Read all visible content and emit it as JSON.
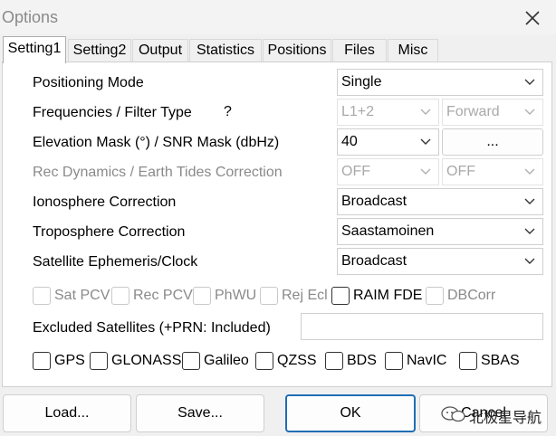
{
  "window": {
    "title": "Options"
  },
  "tabs": [
    "Setting1",
    "Setting2",
    "Output",
    "Statistics",
    "Positions",
    "Files",
    "Misc"
  ],
  "settings": {
    "positioning_mode": {
      "label": "Positioning Mode",
      "value": "Single"
    },
    "frequencies": {
      "label": "Frequencies / Filter Type",
      "help": "?",
      "freq_value": "L1+2",
      "filter_value": "Forward"
    },
    "elevation": {
      "label": "Elevation Mask (°) / SNR Mask (dbHz)",
      "value": "40",
      "snr_button": "..."
    },
    "dynamics": {
      "label": "Rec Dynamics / Earth Tides Correction",
      "dyn_value": "OFF",
      "tides_value": "OFF"
    },
    "ionosphere": {
      "label": "Ionosphere Correction",
      "value": "Broadcast"
    },
    "troposphere": {
      "label": "Troposphere Correction",
      "value": "Saastamoinen"
    },
    "ephemeris": {
      "label": "Satellite Ephemeris/Clock",
      "value": "Broadcast"
    },
    "options": [
      "Sat PCV",
      "Rec PCV",
      "PhWU",
      "Rej Ecl",
      "RAIM FDE",
      "DBCorr"
    ],
    "excluded": {
      "label": "Excluded Satellites (+PRN: Included)",
      "value": ""
    },
    "constellations": [
      "GPS",
      "GLONASS",
      "Galileo",
      "QZSS",
      "BDS",
      "NavIC",
      "SBAS"
    ]
  },
  "buttons": {
    "load": "Load...",
    "save": "Save...",
    "ok": "OK",
    "cancel": "Cancel"
  },
  "watermark": {
    "text": "北极星导航"
  },
  "colors": {
    "accent": "#1f6fb5",
    "disabled_text": "#8a8a8a",
    "panel_bg": "#ffffff",
    "window_bg": "#f0f0f0"
  }
}
